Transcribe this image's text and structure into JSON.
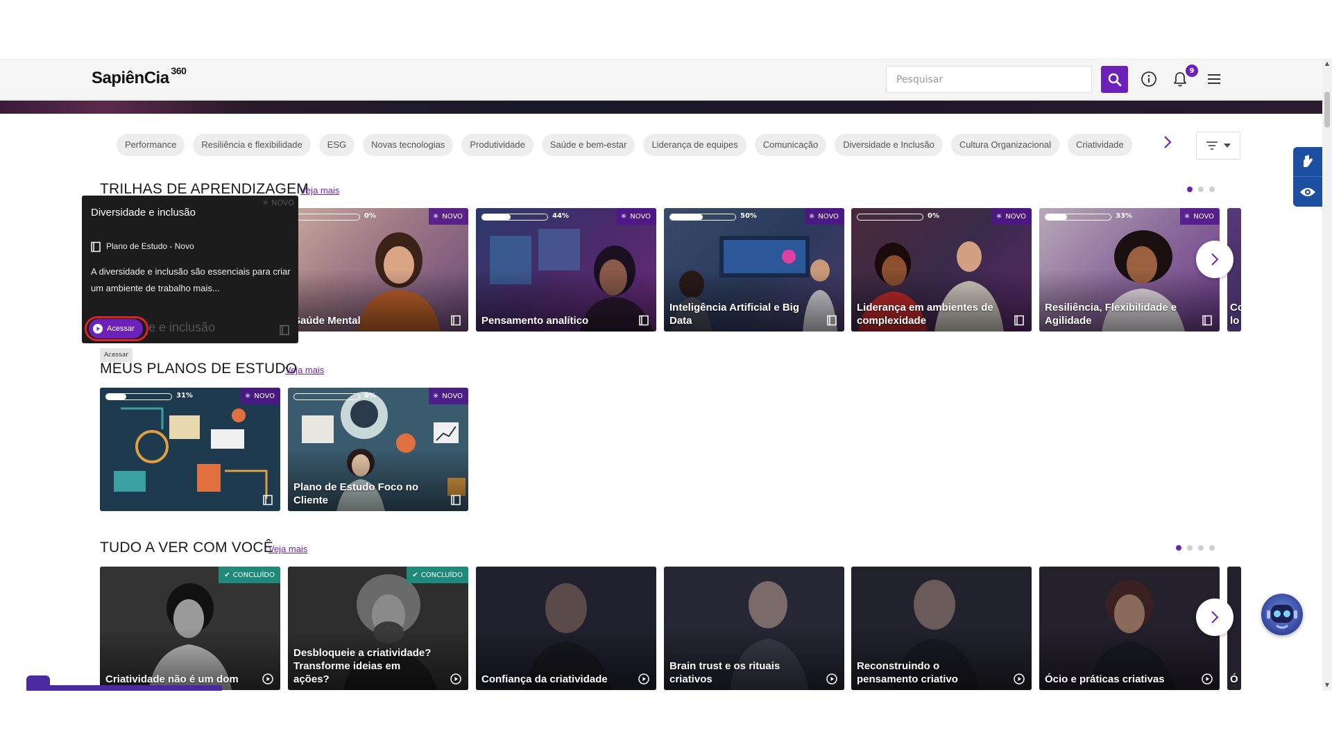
{
  "header": {
    "logo": "SapiênCia",
    "logo_suffix": "360",
    "search_placeholder": "Pesquisar",
    "notifications_count": "9"
  },
  "categories": [
    "Performance",
    "Resiliência e flexibilidade",
    "ESG",
    "Novas tecnologias",
    "Produtividade",
    "Saúde e bem-estar",
    "Liderança de equipes",
    "Comunicação",
    "Diversidade e Inclusão",
    "Cultura Organizacional",
    "Criatividade"
  ],
  "trilhas": {
    "title": "TRILHAS DE APRENDIZAGEM",
    "veja_mais": "Veja mais",
    "cards": [
      {
        "title": "Saúde Mental",
        "progress": "0%",
        "badge": "NOVO"
      },
      {
        "title": "Pensamento analítico",
        "progress": "44%",
        "badge": "NOVO"
      },
      {
        "title": "Inteligência Artificial e Big Data",
        "progress": "50%",
        "badge": "NOVO"
      },
      {
        "title": "Liderança em ambientes de complexidade",
        "progress": "0%",
        "badge": "NOVO"
      },
      {
        "title": "Resiliência, Flexibilidade e Agilidade",
        "progress": "33%",
        "badge": "NOVO"
      },
      {
        "title": "Co lo",
        "progress": "",
        "badge": ""
      }
    ]
  },
  "popover": {
    "title": "Diversidade e inclusão",
    "badge": "NOVO",
    "type": "Plano de Estudo - Novo",
    "description": "A diversidade e inclusão são essenciais para criar um ambiente de trabalho mais...",
    "button": "Acessar",
    "underlay_text": "e e inclusão",
    "tooltip": "Acessar"
  },
  "planos": {
    "title": "MEUS PLANOS DE ESTUDO",
    "veja_mais": "Veja mais",
    "cards": [
      {
        "title": "",
        "progress": "31%",
        "badge": "NOVO"
      },
      {
        "title": "Plano de Estudo Foco no Cliente",
        "progress": "0%",
        "badge": "NOVO"
      }
    ]
  },
  "tudo": {
    "title": "TUDO A VER COM VOCÊ",
    "veja_mais": "Veja mais",
    "cards": [
      {
        "title": "Criatividade não é um dom",
        "badge": "CONCLUÍDO"
      },
      {
        "title": "Desbloqueie a criatividade? Transforme ideias em ações?",
        "badge": "CONCLUÍDO"
      },
      {
        "title": "Confiança da criatividade",
        "badge": ""
      },
      {
        "title": "Brain trust e os rituais criativos",
        "badge": ""
      },
      {
        "title": "Reconstruindo o pensamento criativo",
        "badge": ""
      },
      {
        "title": "Ócio e práticas criativas",
        "badge": ""
      },
      {
        "title": "Ó",
        "badge": ""
      }
    ]
  },
  "progress_values": {
    "trilhas": [
      0,
      0.44,
      0.5,
      0,
      0.33
    ],
    "planos": [
      0.31,
      0
    ]
  },
  "colors": {
    "accent": "#6c22b8",
    "concluido": "#1f8a7a",
    "accessibility": "#1c4fa0"
  }
}
